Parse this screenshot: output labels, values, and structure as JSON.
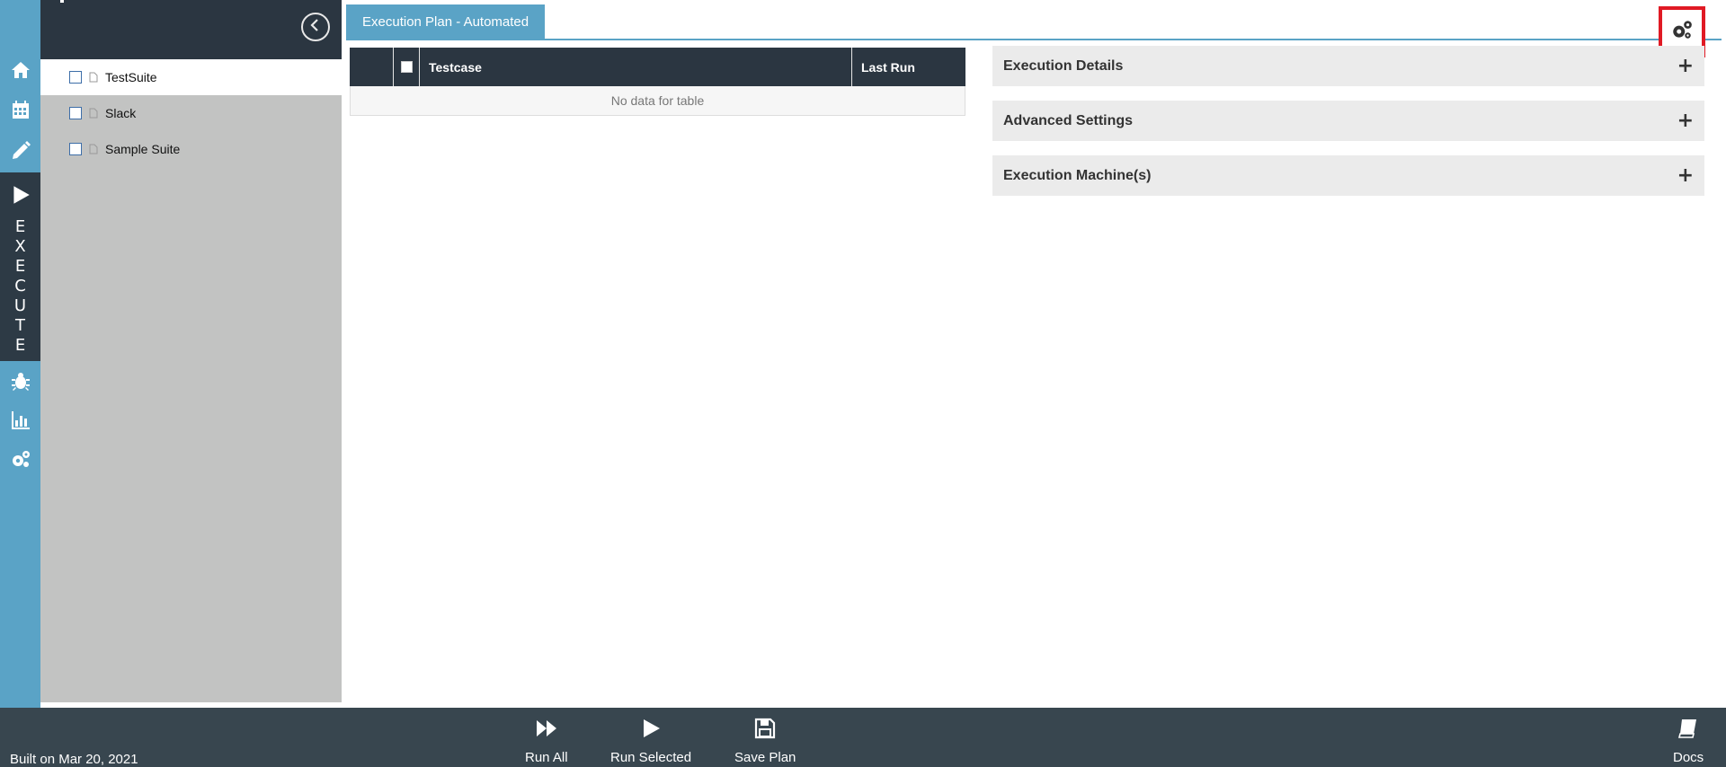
{
  "rail": {
    "execute_letters": [
      "E",
      "X",
      "E",
      "C",
      "U",
      "T",
      "E"
    ]
  },
  "suites": [
    {
      "label": "TestSuite",
      "active": true
    },
    {
      "label": "Slack",
      "active": false
    },
    {
      "label": "Sample Suite",
      "active": false
    }
  ],
  "tabs": {
    "active_label": "Execution Plan - Automated"
  },
  "table": {
    "col_testcase": "Testcase",
    "col_last_run": "Last Run",
    "empty_text": "No data for table"
  },
  "accordions": {
    "execution_details": "Execution Details",
    "advanced_settings": "Advanced Settings",
    "execution_machines": "Execution Machine(s)",
    "expand_symbol": "+"
  },
  "bottom": {
    "build_text": "Built on Mar 20, 2021",
    "run_all": "Run All",
    "run_selected": "Run Selected",
    "save_plan": "Save Plan",
    "docs": "Docs"
  },
  "colors": {
    "rail": "#5aa3c6",
    "dark": "#2b3641",
    "bottom": "#38464f",
    "highlight": "#e01a24"
  }
}
